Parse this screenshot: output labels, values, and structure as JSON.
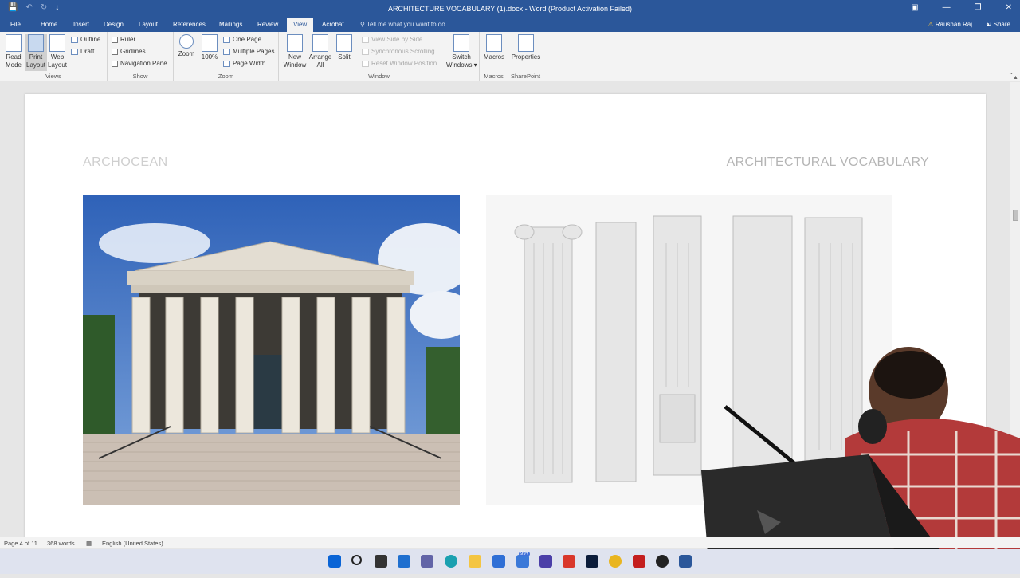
{
  "window": {
    "title": "ARCHITECTURE VOCABULARY (1).docx - Word (Product Activation Failed)",
    "qat": {
      "save": "💾",
      "undo": "↶",
      "redo": "↻",
      "customize": "↓"
    },
    "controls": {
      "ribbon_options": "▣",
      "minimize": "—",
      "restore": "❐",
      "close": "✕"
    }
  },
  "tabs": [
    "File",
    "Home",
    "Insert",
    "Design",
    "Layout",
    "References",
    "Mailings",
    "Review",
    "View",
    "Acrobat"
  ],
  "active_tab": "View",
  "tell_me": "Tell me what you want to do...",
  "user": "Raushan Raj",
  "share": "Share",
  "ribbon": {
    "views": {
      "label": "Views",
      "read": "Read\nMode",
      "print": "Print\nLayout",
      "web": "Web\nLayout",
      "outline": "Outline",
      "draft": "Draft"
    },
    "show": {
      "label": "Show",
      "ruler": "Ruler",
      "gridlines": "Gridlines",
      "nav": "Navigation Pane"
    },
    "zoom": {
      "label": "Zoom",
      "zoom": "Zoom",
      "hundred": "100%",
      "one": "One Page",
      "multiple": "Multiple Pages",
      "width": "Page Width"
    },
    "window": {
      "label": "Window",
      "new": "New\nWindow",
      "arrange": "Arrange\nAll",
      "split": "Split",
      "side": "View Side by Side",
      "sync": "Synchronous Scrolling",
      "reset": "Reset Window Position",
      "switch": "Switch\nWindows ▾"
    },
    "macros": {
      "label": "Macros",
      "macros": "Macros"
    },
    "sharepoint": {
      "label": "SharePoint",
      "properties": "Properties"
    }
  },
  "document": {
    "header_left": "ARCHOCEAN",
    "header_right": "ARCHITECTURAL VOCABULARY"
  },
  "status": {
    "page": "Page 4 of 11",
    "words": "368 words",
    "lang": "English (United States)"
  },
  "taskbar": {
    "badge": "99+"
  },
  "colors": {
    "accent": "#2b579a",
    "header_left": "#cfcfcf",
    "header_right": "#b5b5b5"
  }
}
